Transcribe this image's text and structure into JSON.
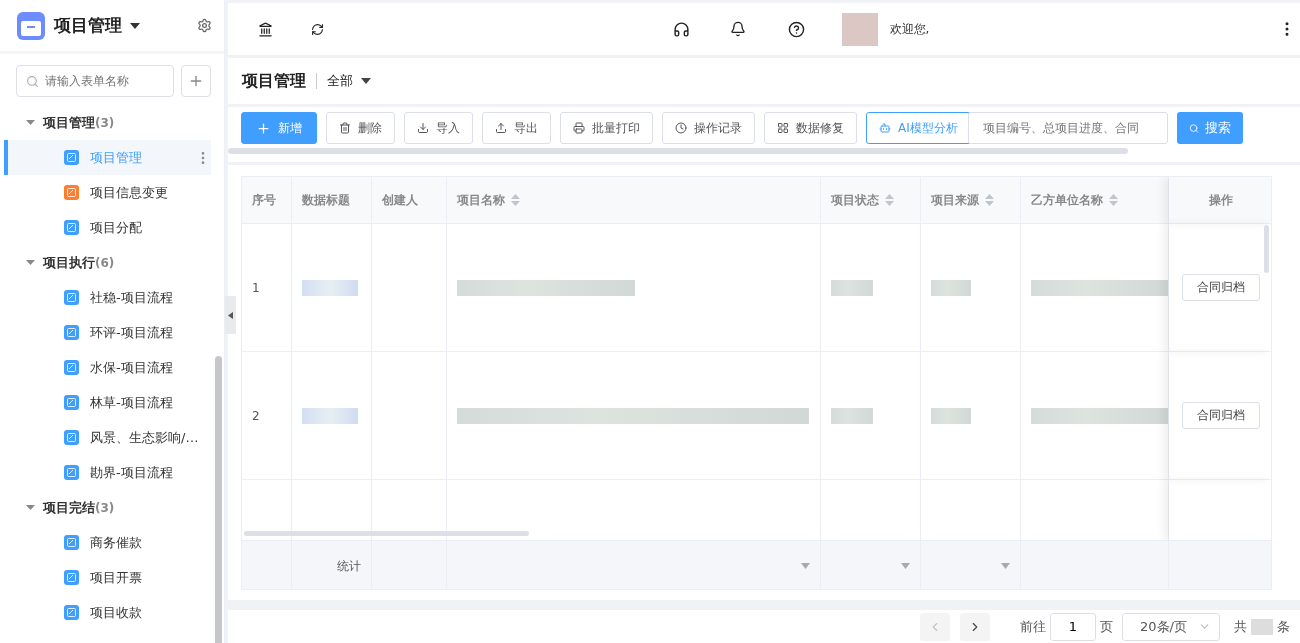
{
  "sidebar": {
    "app_title": "项目管理",
    "search": {
      "placeholder": "请输入表单名称"
    },
    "groups": [
      {
        "label": "项目管理",
        "count": "(3)",
        "expanded": true,
        "items": [
          {
            "label": "项目管理",
            "color": "#409eff",
            "selected": true
          },
          {
            "label": "项目信息变更",
            "color": "#ff7d2f",
            "selected": false
          },
          {
            "label": "项目分配",
            "color": "#409eff",
            "selected": false
          }
        ]
      },
      {
        "label": "项目执行",
        "count": "(6)",
        "expanded": true,
        "items": [
          {
            "label": "社稳-项目流程",
            "color": "#409eff",
            "selected": false
          },
          {
            "label": "环评-项目流程",
            "color": "#409eff",
            "selected": false
          },
          {
            "label": "水保-项目流程",
            "color": "#409eff",
            "selected": false
          },
          {
            "label": "林草-项目流程",
            "color": "#409eff",
            "selected": false
          },
          {
            "label": "风景、生态影响/…",
            "color": "#409eff",
            "selected": false
          },
          {
            "label": "勘界-项目流程",
            "color": "#409eff",
            "selected": false
          }
        ]
      },
      {
        "label": "项目完结",
        "count": "(3)",
        "expanded": true,
        "items": [
          {
            "label": "商务催款",
            "color": "#409eff",
            "selected": false
          },
          {
            "label": "项目开票",
            "color": "#409eff",
            "selected": false
          },
          {
            "label": "项目收款",
            "color": "#409eff",
            "selected": false
          }
        ]
      }
    ]
  },
  "header": {
    "welcome": "欢迎您,"
  },
  "page": {
    "title": "项目管理",
    "filter": "全部"
  },
  "toolbar": {
    "buttons": [
      {
        "label": "新增",
        "kind": "primary"
      },
      {
        "label": "删除",
        "kind": "default"
      },
      {
        "label": "导入",
        "kind": "default"
      },
      {
        "label": "导出",
        "kind": "default"
      },
      {
        "label": "批量打印",
        "kind": "default"
      },
      {
        "label": "操作记录",
        "kind": "default"
      },
      {
        "label": "数据修复",
        "kind": "default"
      },
      {
        "label": "AI模型分析",
        "kind": "outline"
      }
    ],
    "search": {
      "placeholder": "项目编号、总项目进度、合同"
    },
    "search_button": "搜索"
  },
  "table": {
    "columns": [
      {
        "label": "序号",
        "sortable": false
      },
      {
        "label": "数据标题",
        "sortable": false
      },
      {
        "label": "创建人",
        "sortable": false
      },
      {
        "label": "项目名称",
        "sortable": true
      },
      {
        "label": "项目状态",
        "sortable": true
      },
      {
        "label": "项目来源",
        "sortable": true
      },
      {
        "label": "乙方单位名称",
        "sortable": true
      },
      {
        "label": "操作",
        "sortable": false
      }
    ],
    "rows": [
      {
        "index": "1",
        "action": "合同归档"
      },
      {
        "index": "2",
        "action": "合同归档"
      }
    ],
    "summary_label": "统计"
  },
  "pagination": {
    "prev_disabled": true,
    "goto": "前往",
    "page": "1",
    "page_unit": "页",
    "page_size": "20条/页",
    "total_prefix": "共",
    "total_suffix": "条"
  }
}
